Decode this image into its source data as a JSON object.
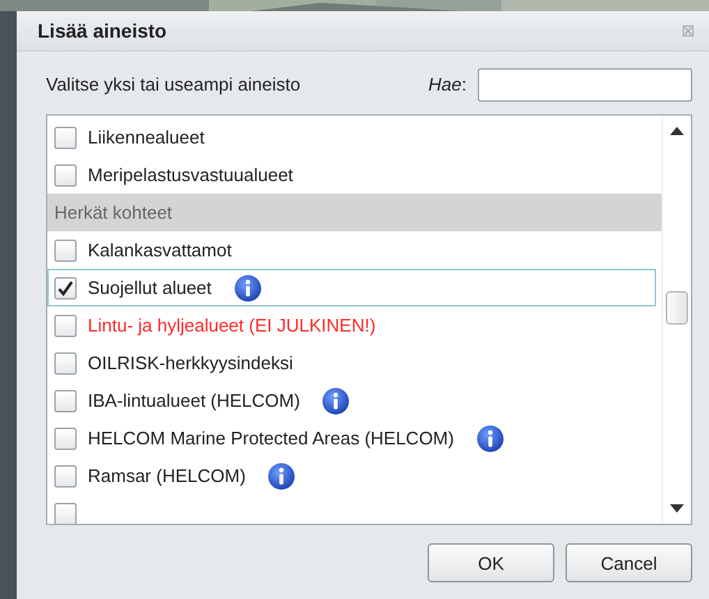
{
  "dialog": {
    "title": "Lisää aineisto",
    "close": "⊠"
  },
  "prompt": "Valitse yksi tai useampi aineisto",
  "search": {
    "label": "Hae",
    "colon": ":"
  },
  "list": [
    {
      "kind": "item",
      "label": "Liikennealueet",
      "checked": false,
      "focused": false,
      "warning": false,
      "info": false
    },
    {
      "kind": "item",
      "label": "Meripelastusvastuualueet",
      "checked": false,
      "focused": false,
      "warning": false,
      "info": false
    },
    {
      "kind": "group",
      "label": "Herkät kohteet"
    },
    {
      "kind": "item",
      "label": "Kalankasvattamot",
      "checked": false,
      "focused": false,
      "warning": false,
      "info": false
    },
    {
      "kind": "item",
      "label": "Suojellut alueet",
      "checked": true,
      "focused": true,
      "warning": false,
      "info": true
    },
    {
      "kind": "item",
      "label": "Lintu- ja hyljealueet (EI JULKINEN!)",
      "checked": false,
      "focused": false,
      "warning": true,
      "info": false
    },
    {
      "kind": "item",
      "label": "OILRISK-herkkyysindeksi",
      "checked": false,
      "focused": false,
      "warning": false,
      "info": false
    },
    {
      "kind": "item",
      "label": "IBA-lintualueet (HELCOM)",
      "checked": false,
      "focused": false,
      "warning": false,
      "info": true
    },
    {
      "kind": "item",
      "label": "HELCOM Marine Protected Areas (HELCOM)",
      "checked": false,
      "focused": false,
      "warning": false,
      "info": true
    },
    {
      "kind": "item",
      "label": "Ramsar (HELCOM)",
      "checked": false,
      "focused": false,
      "warning": false,
      "info": true
    },
    {
      "kind": "partial",
      "checked": false
    }
  ],
  "buttons": [
    "OK",
    "Cancel"
  ]
}
